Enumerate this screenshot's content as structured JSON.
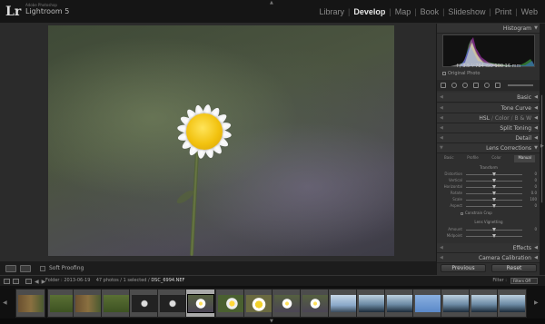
{
  "app": {
    "logo": "Lr",
    "sub": "Adobe Photoshop",
    "name": "Lightroom 5"
  },
  "modules": [
    "Library",
    "Develop",
    "Map",
    "Book",
    "Slideshow",
    "Print",
    "Web"
  ],
  "active_module": "Develop",
  "right_panel": {
    "histogram_label": "Histogram",
    "readout": "f / 3.5    ⅟ 784    ISO 100    16 mm",
    "original_photo": "Original Photo",
    "sections": {
      "basic": "Basic",
      "tone_curve": "Tone Curve",
      "hsl": "HSL",
      "color": "Color",
      "bw": "B & W",
      "split_toning": "Split Toning",
      "detail": "Detail",
      "lens_corrections": "Lens Corrections",
      "effects": "Effects",
      "camera_calibration": "Camera Calibration"
    },
    "lens_tabs": [
      "Basic",
      "Profile",
      "Color",
      "Manual"
    ],
    "transform_title": "Transform",
    "transform_sliders": [
      {
        "label": "Distortion",
        "value": "0",
        "pos": 0.5
      },
      {
        "label": "Vertical",
        "value": "0",
        "pos": 0.5
      },
      {
        "label": "Horizontal",
        "value": "0",
        "pos": 0.5
      },
      {
        "label": "Rotate",
        "value": "0.0",
        "pos": 0.5
      },
      {
        "label": "Scale",
        "value": "100",
        "pos": 0.5
      },
      {
        "label": "Aspect",
        "value": "0",
        "pos": 0.5
      }
    ],
    "constrain_crop": "Constrain Crop",
    "vignetting_title": "Lens Vignetting",
    "vignetting_sliders": [
      {
        "label": "Amount",
        "value": "0",
        "pos": 0.5
      },
      {
        "label": "Midpoint",
        "value": "",
        "pos": 0.5
      }
    ],
    "previous": "Previous",
    "reset": "Reset"
  },
  "toolbar": {
    "soft_proofing": "Soft Proofing"
  },
  "filmstrip": {
    "folder": "Folder : 2013-06-19",
    "count": "47 photos / 1 selected /",
    "filename": "DSC_6994.NEF",
    "filter_label": "Filter :",
    "filter_value": "Filters Off"
  }
}
